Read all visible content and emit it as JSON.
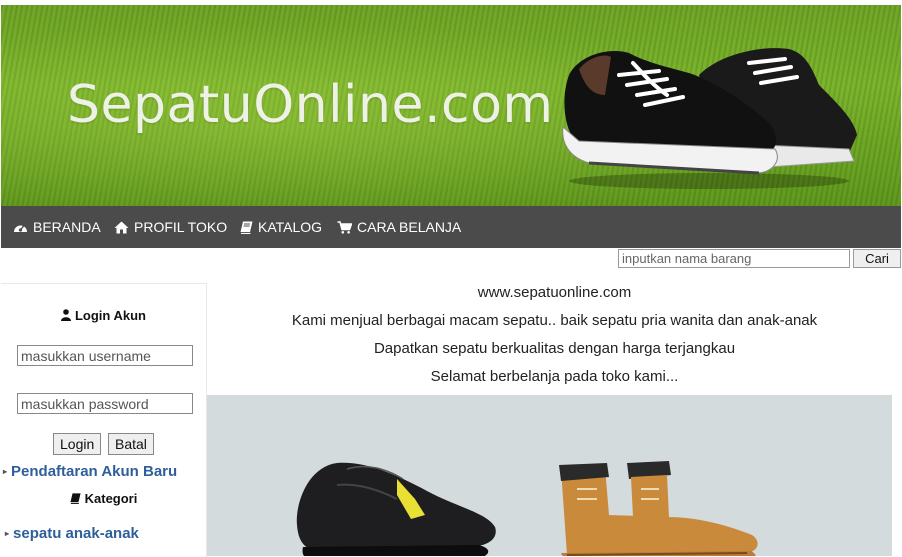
{
  "header": {
    "site_title": "SepatuOnline.com"
  },
  "nav": {
    "items": [
      {
        "label": "BERANDA",
        "icon": "dashboard-icon"
      },
      {
        "label": "PROFIL TOKO",
        "icon": "home-icon"
      },
      {
        "label": "KATALOG",
        "icon": "book-icon"
      },
      {
        "label": "CARA BELANJA",
        "icon": "cart-icon"
      }
    ]
  },
  "search": {
    "placeholder": "inputkan nama barang",
    "button_label": "Cari"
  },
  "sidebar": {
    "login_title": "Login Akun",
    "username_placeholder": "masukkan username",
    "password_placeholder": "masukkan password",
    "login_label": "Login",
    "cancel_label": "Batal",
    "register_link": "Pendaftaran Akun Baru",
    "category_title": "Kategori",
    "categories": [
      "sepatu anak-anak"
    ]
  },
  "main": {
    "lines": [
      "www.sepatuonline.com",
      "Kami menjual berbagai macam sepatu.. baik sepatu pria wanita dan anak-anak",
      "Dapatkan sepatu berkualitas dengan harga terjangkau",
      "Selamat berbelanja pada toko kami..."
    ]
  },
  "colors": {
    "nav_bg": "#4b4b4b",
    "link": "#2e5f9a",
    "banner_green": "#7db52d",
    "showcase_bg": "#d4dbdc"
  }
}
